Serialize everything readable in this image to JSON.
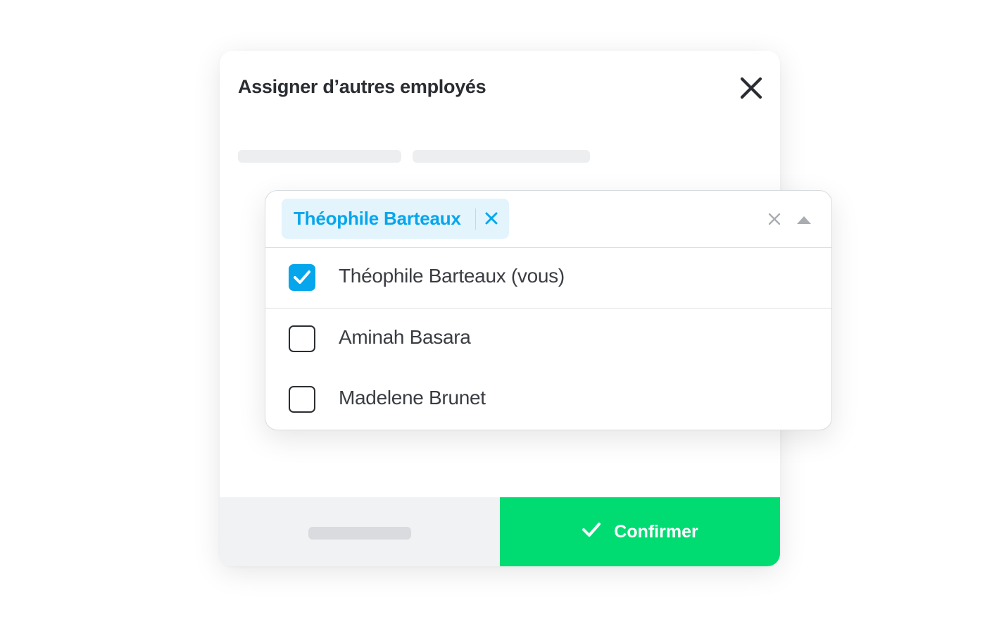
{
  "modal": {
    "title": "Assigner d’autres employés",
    "confirm_label": "Confirmer",
    "close_icon": "close-icon",
    "confirm_icon": "check-icon"
  },
  "dropdown": {
    "selected_chip": "Théophile Barteaux",
    "options": [
      {
        "label": "Théophile Barteaux (vous)",
        "checked": true
      },
      {
        "label": "Aminah Basara",
        "checked": false
      },
      {
        "label": "Madelene Brunet",
        "checked": false
      }
    ]
  },
  "colors": {
    "accent": "#06a6ec",
    "confirm": "#00db72",
    "chip_bg": "#e3f4fd"
  }
}
